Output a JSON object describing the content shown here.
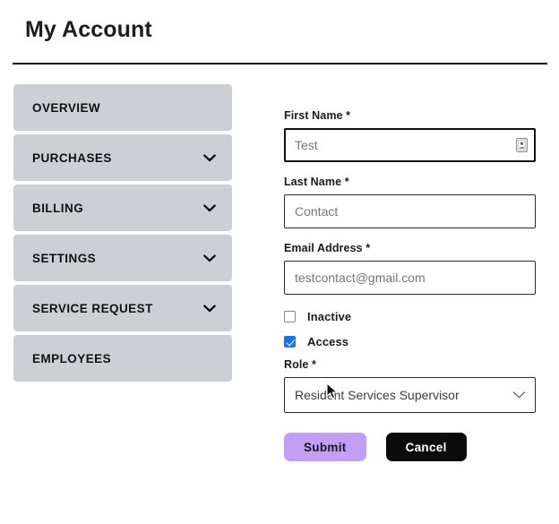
{
  "header": {
    "title": "My Account"
  },
  "sidebar": {
    "items": [
      {
        "label": "OVERVIEW",
        "expandable": false
      },
      {
        "label": "PURCHASES",
        "expandable": true
      },
      {
        "label": "BILLING",
        "expandable": true
      },
      {
        "label": "SETTINGS",
        "expandable": true
      },
      {
        "label": "SERVICE REQUEST",
        "expandable": true
      },
      {
        "label": "EMPLOYEES",
        "expandable": false
      }
    ]
  },
  "form": {
    "first_name": {
      "label": "First Name *",
      "value": "",
      "placeholder": "Test"
    },
    "last_name": {
      "label": "Last Name *",
      "value": "",
      "placeholder": "Contact"
    },
    "email": {
      "label": "Email Address *",
      "value": "",
      "placeholder": "testcontact@gmail.com"
    },
    "inactive": {
      "label": "Inactive",
      "checked": false
    },
    "access": {
      "label": "Access",
      "checked": true
    },
    "role": {
      "label": "Role *",
      "value": "Resident Services Supervisor"
    },
    "submit_label": "Submit",
    "cancel_label": "Cancel"
  },
  "icons": {
    "chevron_down": "chevron-down-icon",
    "autofill": "contact-autofill-icon",
    "cursor": "mouse-pointer"
  },
  "colors": {
    "sidebar_item_bg": "#ccd0d5",
    "submit_bg": "#c29ef5",
    "cancel_bg": "#0b0b0b",
    "checkbox_checked": "#1a73e8",
    "rule": "#0a0a0a"
  }
}
